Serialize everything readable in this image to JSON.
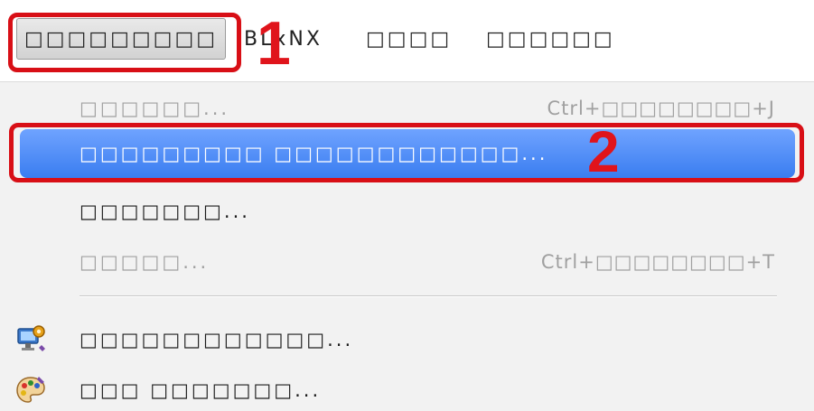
{
  "menubar": {
    "items": [
      {
        "label": "□□□□□□□□□",
        "underline_first": true
      },
      {
        "label": "BLxNX"
      },
      {
        "label": "□□□□",
        "underline_index": 2
      },
      {
        "label": "□□□□□□",
        "underline_first": true
      }
    ]
  },
  "dropdown": {
    "items": [
      {
        "label": "□□□□□□...",
        "accelerator": "Ctrl+□□□□□□□□+J",
        "disabled": true
      },
      {
        "label": "□□□□□□□□□ □□□□□□□□□□□□...",
        "accelerator": "",
        "selected": true
      },
      {
        "label": "□□□□□□□...",
        "accelerator": ""
      },
      {
        "label": "□□□□□...",
        "accelerator": "Ctrl+□□□□□□□□+T",
        "disabled": true
      },
      {
        "label": "□□□□□□□□□□□□...",
        "accelerator": "",
        "icon": "computer-gear-icon"
      },
      {
        "label": "□□□ □□□□□□□...",
        "accelerator": "",
        "icon": "palette-icon"
      }
    ]
  },
  "annotations": {
    "step1": "1",
    "step2": "2",
    "color": "#d80f16"
  },
  "colors": {
    "selection": "#4a8af5",
    "disabled_text": "#a0a0a0",
    "menu_bg": "#f2f2f2"
  }
}
